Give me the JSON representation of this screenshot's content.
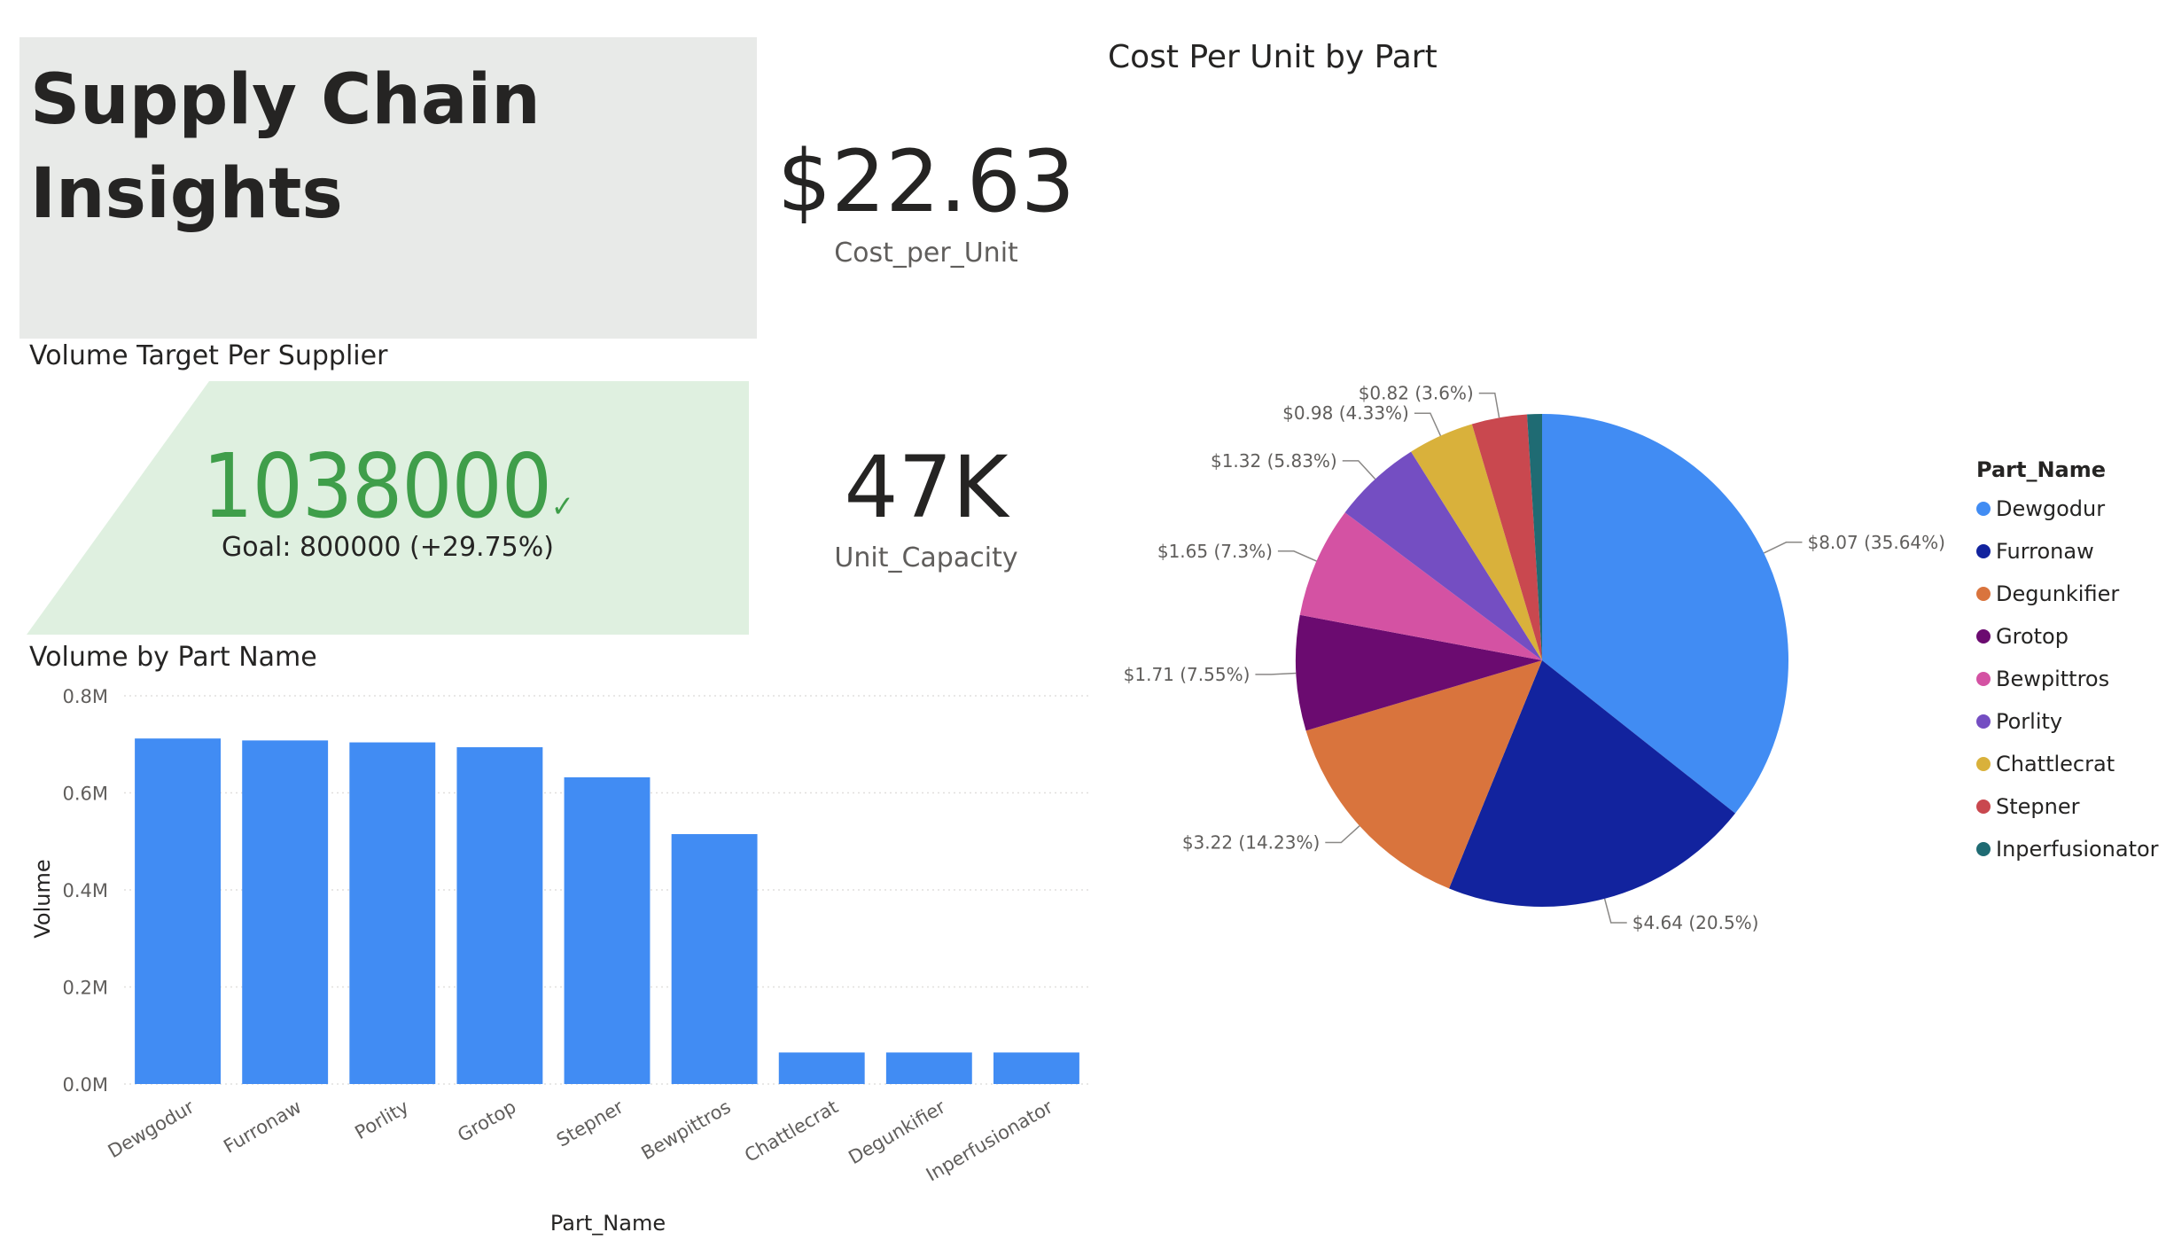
{
  "title": {
    "line1": "Supply Chain",
    "line2": "Insights"
  },
  "cost_card": {
    "value": "$22.63",
    "label": "Cost_per_Unit"
  },
  "capacity_card": {
    "value": "47K",
    "label": "Unit_Capacity"
  },
  "kpi": {
    "section_title": "Volume Target Per Supplier",
    "value": "1038000",
    "check": "✓",
    "goal_text": "Goal: 800000 (+29.75%)",
    "fill_color": "#dff0e0",
    "value_color": "#3f9e4a"
  },
  "bar_section_title": "Volume by Part Name",
  "pie_section_title": "Cost Per Unit by Part",
  "legend_title": "Part_Name",
  "chart_data": [
    {
      "type": "bar",
      "title": "Volume by Part Name",
      "xlabel": "Part_Name",
      "ylabel": "Volume",
      "ylim": [
        0,
        800000
      ],
      "yticks": [
        "0.0M",
        "0.2M",
        "0.4M",
        "0.6M",
        "0.8M"
      ],
      "categories": [
        "Dewgodur",
        "Furronaw",
        "Porlity",
        "Grotop",
        "Stepner",
        "Bewpittros",
        "Chattlecrat",
        "Degunkifier",
        "Inperfusionator"
      ],
      "values": [
        712000,
        708000,
        704000,
        694000,
        632000,
        515000,
        65000,
        65000,
        65000
      ],
      "color": "#418cf3",
      "grid": true
    },
    {
      "type": "pie",
      "title": "Cost Per Unit by Part",
      "legend_title": "Part_Name",
      "legend_position": "right",
      "labels": [
        "Dewgodur",
        "Furronaw",
        "Degunkifier",
        "Grotop",
        "Bewpittros",
        "Porlity",
        "Chattlecrat",
        "Stepner",
        "Inperfusionator"
      ],
      "values": [
        8.07,
        4.64,
        3.22,
        1.71,
        1.65,
        1.32,
        0.98,
        0.82,
        0.22
      ],
      "data_labels": [
        "$8.07 (35.64%)",
        "$4.64 (20.5%)",
        "$3.22 (14.23%)",
        "$1.71 (7.55%)",
        "$1.65 (7.3%)",
        "$1.32 (5.83%)",
        "$0.98 (4.33%)",
        "$0.82 (3.6%)",
        ""
      ],
      "colors": [
        "#418cf3",
        "#12239e",
        "#d9743d",
        "#6b0b70",
        "#d452a3",
        "#744ec2",
        "#d9b13b",
        "#c9484f",
        "#1f6b73"
      ]
    }
  ]
}
